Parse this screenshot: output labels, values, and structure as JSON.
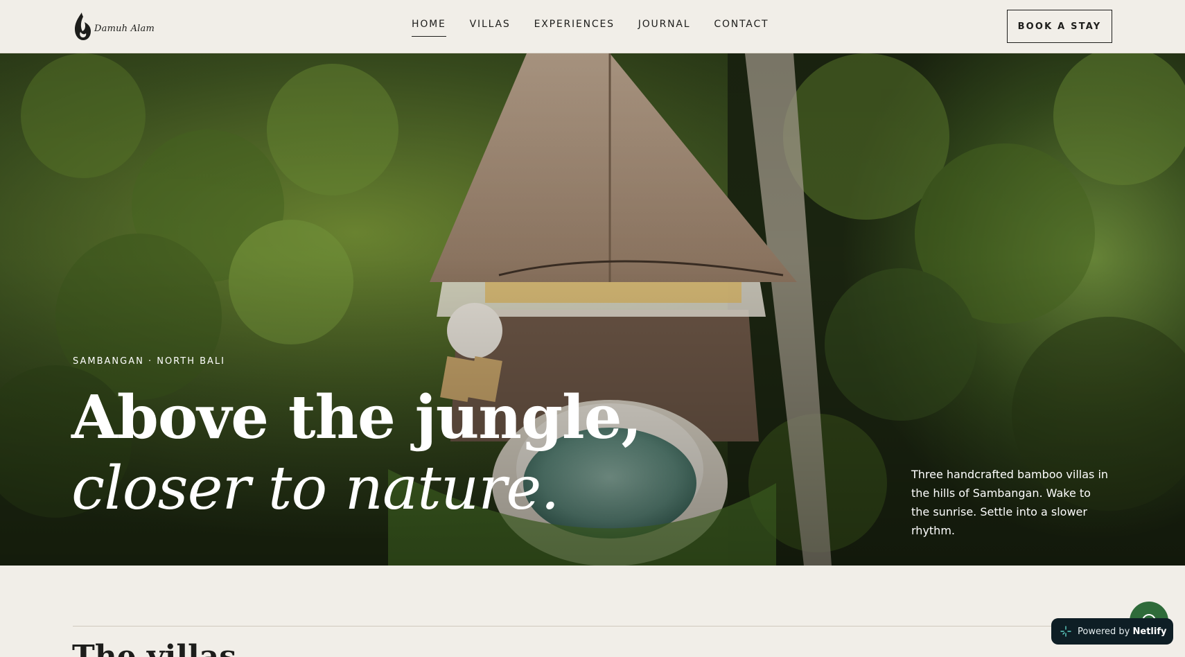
{
  "brand": {
    "name": "Damuh Alam",
    "logo_icon": "flame-drop-icon"
  },
  "nav": {
    "items": [
      {
        "label": "HOME",
        "active": true
      },
      {
        "label": "VILLAS",
        "active": false
      },
      {
        "label": "EXPERIENCES",
        "active": false
      },
      {
        "label": "JOURNAL",
        "active": false
      },
      {
        "label": "CONTACT",
        "active": false
      }
    ]
  },
  "header": {
    "cta_label": "BOOK A STAY"
  },
  "hero": {
    "eyebrow": "SAMBANGAN · NORTH BALI",
    "headline_line1": "Above the jungle,",
    "headline_line2": "closer to nature.",
    "description": "Three handcrafted bamboo villas in the hills of Sambangan. Wake to the sunrise. Settle into a slower rhythm."
  },
  "section": {
    "title": "The villas"
  },
  "widgets": {
    "chat_icon": "whatsapp-chat-icon",
    "badge_prefix": "Powered by",
    "badge_brand": "Netlify"
  },
  "colors": {
    "background": "#f1eee8",
    "text": "#1d1d1b",
    "foliage": "#2f3e1e",
    "chat_button": "#2f6b3a",
    "badge": "#0e1e25"
  }
}
